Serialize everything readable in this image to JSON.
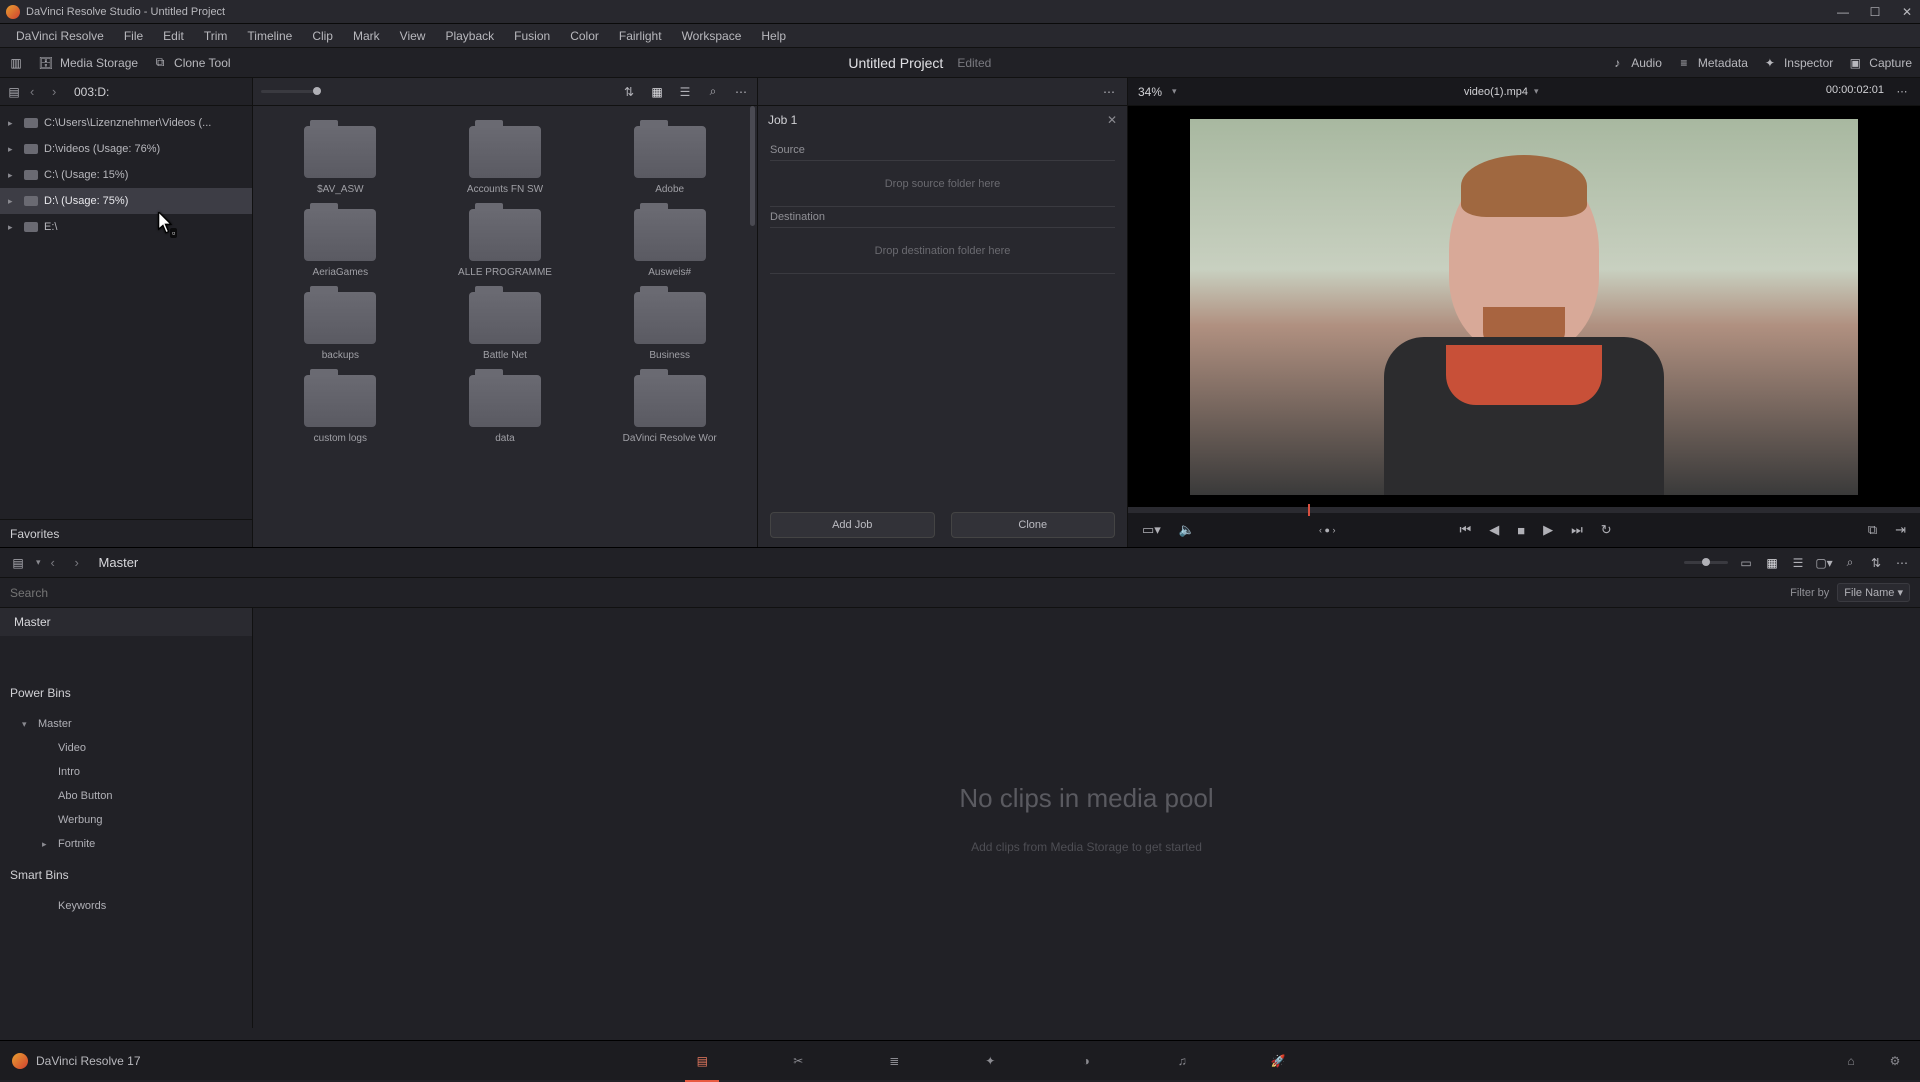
{
  "titlebar": {
    "text": "DaVinci Resolve Studio - Untitled Project"
  },
  "menubar": [
    "DaVinci Resolve",
    "File",
    "Edit",
    "Trim",
    "Timeline",
    "Clip",
    "Mark",
    "View",
    "Playback",
    "Fusion",
    "Color",
    "Fairlight",
    "Workspace",
    "Help"
  ],
  "toolbar": {
    "media_storage": "Media Storage",
    "clone_tool": "Clone Tool",
    "project_name": "Untitled Project",
    "project_status": "Edited",
    "audio": "Audio",
    "metadata": "Metadata",
    "inspector": "Inspector",
    "capture": "Capture"
  },
  "path": {
    "label": "003:D:"
  },
  "drives": [
    {
      "label": "C:\\Users\\Lizenznehmer\\Videos (...",
      "selected": false
    },
    {
      "label": "D:\\videos (Usage: 76%)",
      "selected": false
    },
    {
      "label": "C:\\ (Usage: 15%)",
      "selected": false
    },
    {
      "label": "D:\\ (Usage: 75%)",
      "selected": true
    },
    {
      "label": "E:\\",
      "selected": false
    }
  ],
  "favorites_label": "Favorites",
  "folders": [
    "$AV_ASW",
    "Accounts FN SW",
    "Adobe",
    "AeriaGames",
    "ALLE PROGRAMME",
    "Ausweis#",
    "backups",
    "Battle Net",
    "Business",
    "custom logs",
    "data",
    "DaVinci Resolve Wor"
  ],
  "clone": {
    "job_title": "Job 1",
    "source_label": "Source",
    "source_drop": "Drop source folder here",
    "dest_label": "Destination",
    "dest_drop": "Drop destination folder here",
    "add_job": "Add Job",
    "clone": "Clone"
  },
  "viewer": {
    "zoom": "34%",
    "clip_name": "video(1).mp4",
    "timecode": "00:00:02:01"
  },
  "pool": {
    "master_crumb": "Master",
    "search_placeholder": "Search",
    "filter_by": "Filter by",
    "filter_value": "File Name",
    "master_header": "Master",
    "power_bins": "Power Bins",
    "bins": [
      {
        "label": "Master",
        "level": 1,
        "expandable": true
      },
      {
        "label": "Video",
        "level": 2,
        "expandable": false
      },
      {
        "label": "Intro",
        "level": 2,
        "expandable": false
      },
      {
        "label": "Abo Button",
        "level": 2,
        "expandable": false
      },
      {
        "label": "Werbung",
        "level": 2,
        "expandable": false
      },
      {
        "label": "Fortnite",
        "level": 2,
        "expandable": true
      }
    ],
    "smart_bins": "Smart Bins",
    "smart_items": [
      "Keywords"
    ],
    "empty_big": "No clips in media pool",
    "empty_small": "Add clips from Media Storage to get started"
  },
  "pagenav": {
    "brand": "DaVinci Resolve 17"
  }
}
